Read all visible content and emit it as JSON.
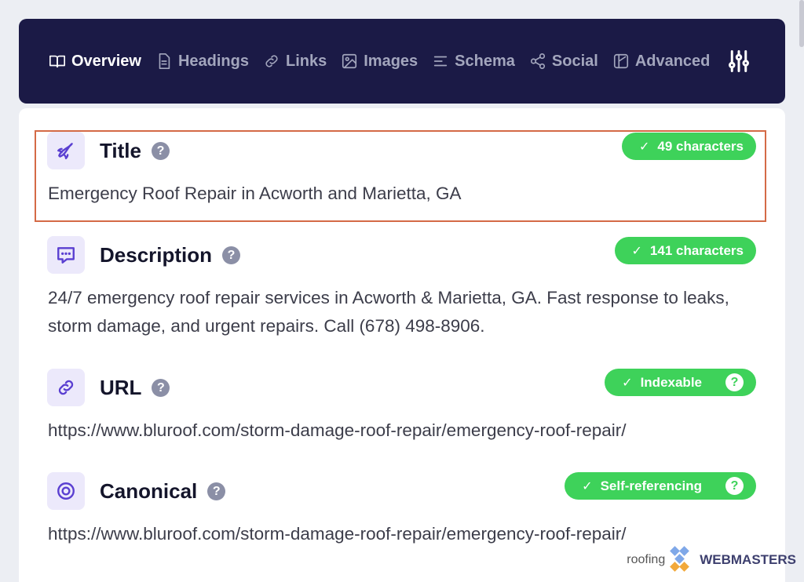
{
  "nav": {
    "tabs": [
      {
        "label": "Overview",
        "icon": "book-icon",
        "active": true
      },
      {
        "label": "Headings",
        "icon": "document-icon",
        "active": false
      },
      {
        "label": "Links",
        "icon": "link-icon",
        "active": false
      },
      {
        "label": "Images",
        "icon": "image-icon",
        "active": false
      },
      {
        "label": "Schema",
        "icon": "list-icon",
        "active": false
      },
      {
        "label": "Social",
        "icon": "share-icon",
        "active": false
      },
      {
        "label": "Advanced",
        "icon": "advanced-icon",
        "active": false
      }
    ],
    "settings_icon": "sliders-icon"
  },
  "sections": {
    "title": {
      "heading": "Title",
      "help": "?",
      "badge": "49 characters",
      "check": "✓",
      "text": "Emergency Roof Repair in Acworth and Marietta, GA",
      "icon": "rocket-icon"
    },
    "description": {
      "heading": "Description",
      "help": "?",
      "badge": "141 characters",
      "check": "✓",
      "text": "24/7 emergency roof repair services in Acworth & Marietta, GA. Fast response to leaks, storm damage, and urgent repairs. Call (678) 498-8906.",
      "icon": "comment-icon"
    },
    "url": {
      "heading": "URL",
      "help": "?",
      "badge": "Indexable",
      "check": "✓",
      "badge_help": "?",
      "text": "https://www.bluroof.com/storm-damage-roof-repair/emergency-roof-repair/",
      "icon": "link-icon"
    },
    "canonical": {
      "heading": "Canonical",
      "help": "?",
      "badge": "Self-referencing",
      "check": "✓",
      "badge_help": "?",
      "text": "https://www.bluroof.com/storm-damage-roof-repair/emergency-roof-repair/",
      "icon": "target-icon"
    }
  },
  "watermark": {
    "prefix": "roofing",
    "brand": "WEBMASTERS"
  },
  "colors": {
    "nav_bg": "#1b1a46",
    "badge_green": "#3ed25a",
    "accent_purple": "#5a3fd1",
    "highlight": "#d46a46"
  }
}
